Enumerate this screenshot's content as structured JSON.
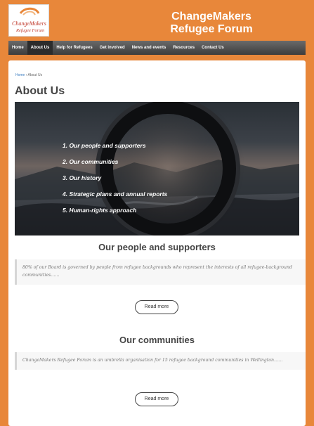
{
  "header": {
    "logo_text": "ChangeMakers Refugee Forum",
    "site_title_line1": "ChangeMakers",
    "site_title_line2": "Refugee Forum"
  },
  "nav": {
    "items": [
      {
        "label": "Home"
      },
      {
        "label": "About Us"
      },
      {
        "label": "Help for Refugees"
      },
      {
        "label": "Get involved"
      },
      {
        "label": "News and events"
      },
      {
        "label": "Resources"
      },
      {
        "label": "Contact Us"
      }
    ]
  },
  "breadcrumb": {
    "home": "Home",
    "separator": "›",
    "current": "About Us"
  },
  "page": {
    "title": "About Us"
  },
  "hero": {
    "links": [
      "1. Our people and supporters",
      "2. Our communities",
      "3. Our history",
      "4. Strategic plans and annual reports",
      "5. Human-rights approach"
    ]
  },
  "sections": [
    {
      "heading": "Our people and supporters",
      "text": "80% of our Board is governed by people from refugee backgrounds who represent the interests of all refugee-background communities……",
      "button": "Read more"
    },
    {
      "heading": "Our communities",
      "text": "ChangeMakers Refugee Forum is an umbrella organisation for 15 refugee background communities in Wellington……",
      "button": "Read more"
    }
  ],
  "colors": {
    "brand_orange": "#e8873a",
    "nav_dark": "#3c3c3c",
    "logo_red": "#c0392b"
  }
}
